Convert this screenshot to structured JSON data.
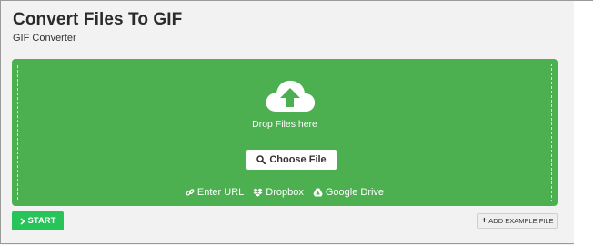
{
  "header": {
    "title": "Convert Files To GIF",
    "subtitle": "GIF Converter"
  },
  "upload": {
    "drop_text": "Drop Files here",
    "choose_label": "Choose File",
    "sources": [
      {
        "label": "Enter URL",
        "icon": "link-icon"
      },
      {
        "label": "Dropbox",
        "icon": "dropbox-icon"
      },
      {
        "label": "Google Drive",
        "icon": "google-drive-icon"
      }
    ]
  },
  "actions": {
    "start_label": "START",
    "add_example_label": "ADD EXAMPLE FILE"
  },
  "colors": {
    "drop_zone": "#4caf50",
    "start_button": "#28c45a"
  }
}
